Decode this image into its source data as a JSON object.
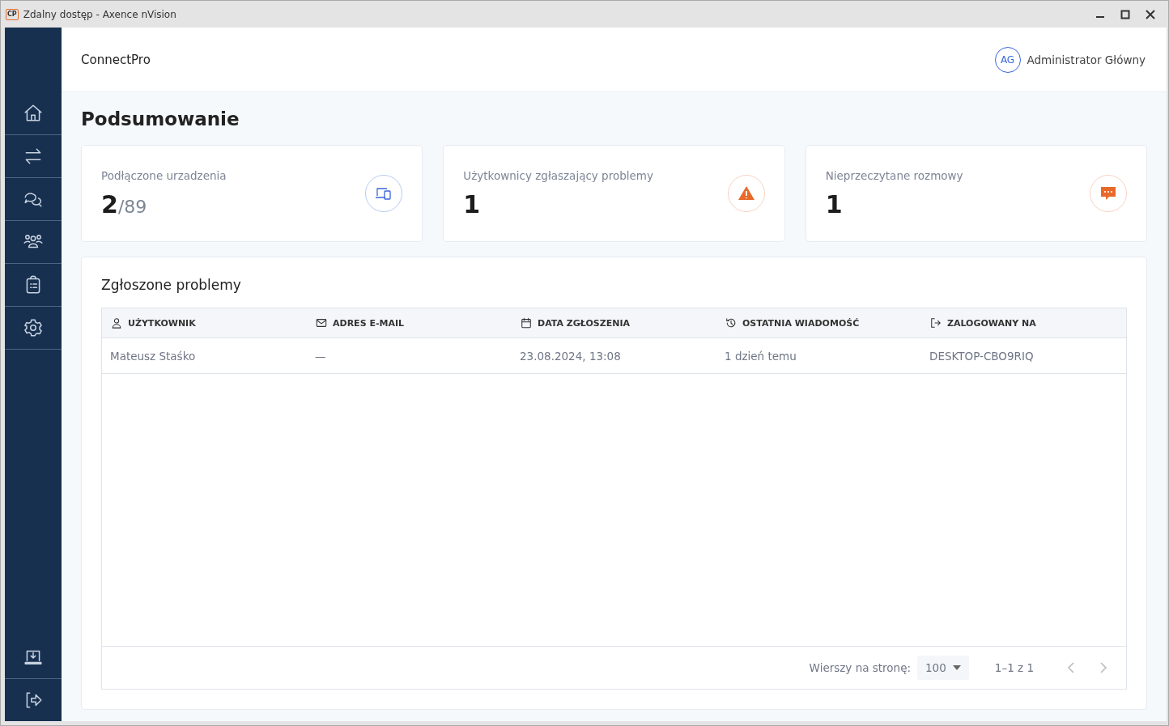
{
  "window": {
    "title": "Zdalny dostęp - Axence nVision",
    "logo": "CP"
  },
  "sidebar": {
    "items": [
      {
        "kind": "home"
      },
      {
        "kind": "transfer"
      },
      {
        "kind": "chat"
      },
      {
        "kind": "users"
      },
      {
        "kind": "clipboard"
      },
      {
        "kind": "settings"
      }
    ],
    "bottom_items": [
      {
        "kind": "download"
      },
      {
        "kind": "logout"
      }
    ]
  },
  "header": {
    "app_name": "ConnectPro",
    "user": {
      "initials": "AG",
      "name": "Administrator Główny"
    }
  },
  "page_title": "Podsumowanie",
  "stats": [
    {
      "label": "Podłączone urzadzenia",
      "value": "2",
      "total": "/89",
      "kind": "devices"
    },
    {
      "label": "Użytkownicy zgłaszający problemy",
      "value": "1",
      "kind": "warning"
    },
    {
      "label": "Nieprzeczytane rozmowy",
      "value": "1",
      "kind": "chat"
    }
  ],
  "problems": {
    "title": "Zgłoszone problemy",
    "columns": [
      {
        "label": "UŻYTKOWNIK",
        "kind": "user"
      },
      {
        "label": "ADRES E-MAIL",
        "kind": "mail"
      },
      {
        "label": "DATA ZGŁOSZENIA",
        "kind": "calendar"
      },
      {
        "label": "OSTATNIA WIADOMOŚĆ",
        "kind": "history"
      },
      {
        "label": "ZALOGOWANY NA",
        "kind": "login"
      }
    ],
    "rows": [
      [
        "Mateusz Staśko",
        "—",
        "23.08.2024, 13:08",
        "1 dzień temu",
        "DESKTOP-CBO9RIQ"
      ]
    ],
    "pagination": {
      "rows_label": "Wierszy na stronę:",
      "rows_per_page": "100",
      "range": "1–1 z 1",
      "prev_disabled": true,
      "next_disabled": true
    }
  }
}
